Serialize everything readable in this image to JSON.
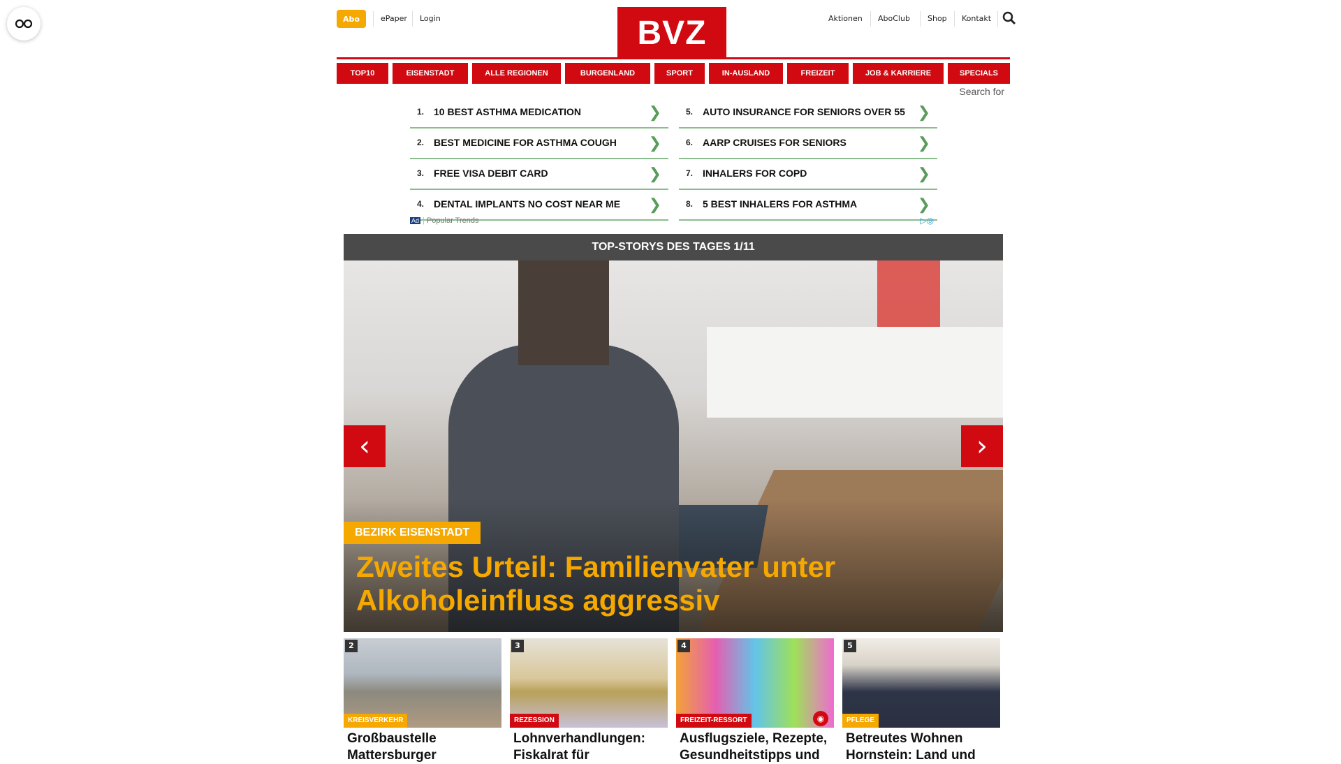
{
  "header": {
    "abo_label": "Abo",
    "left_links": [
      "ePaper",
      "Login"
    ],
    "logo_text": "BVZ",
    "right_links": [
      "Aktionen",
      "AboClub",
      "Shop",
      "Kontakt"
    ]
  },
  "nav": {
    "items": [
      "TOP10",
      "EISENSTADT",
      "ALLE REGIONEN",
      "BURGENLAND",
      "SPORT",
      "IN-AUSLAND",
      "FREIZEIT",
      "JOB & KARRIERE",
      "SPECIALS"
    ]
  },
  "search_for": "Search for",
  "ad": {
    "left": [
      {
        "num": "1.",
        "text": "10 BEST ASTHMA MEDICATION"
      },
      {
        "num": "2.",
        "text": "BEST MEDICINE FOR ASTHMA COUGH"
      },
      {
        "num": "3.",
        "text": "FREE VISA DEBIT CARD"
      },
      {
        "num": "4.",
        "text": "DENTAL IMPLANTS NO COST NEAR ME"
      }
    ],
    "right": [
      {
        "num": "5.",
        "text": "AUTO INSURANCE FOR SENIORS OVER 55"
      },
      {
        "num": "6.",
        "text": "AARP CRUISES FOR SENIORS"
      },
      {
        "num": "7.",
        "text": "INHALERS FOR COPD"
      },
      {
        "num": "8.",
        "text": "5 BEST INHALERS FOR ASTHMA"
      }
    ],
    "badge": "Ad",
    "footer": "Popular Trends"
  },
  "top_stories": {
    "heading": "TOP-STORYS DES TAGES 1/11",
    "hero_tag": "BEZIRK EISENSTADT",
    "hero_title": "Zweites Urteil: Familienvater unter Alkoholeinfluss aggressiv"
  },
  "cards": [
    {
      "rank": "2",
      "tag": "KREISVERKEHR",
      "tag_color": "#f5a800",
      "title": "Großbaustelle Mattersburger"
    },
    {
      "rank": "3",
      "tag": "REZESSION",
      "tag_color": "#d10a11",
      "title": "Lohnverhandlungen: Fiskalrat für"
    },
    {
      "rank": "4",
      "tag": "FREIZEIT-RESSORT",
      "tag_color": "#d10a11",
      "title": "Ausflugsziele, Rezepte, Gesundheitstipps und"
    },
    {
      "rank": "5",
      "tag": "PFLEGE",
      "tag_color": "#f5a800",
      "title": "Betreutes Wohnen Hornstein: Land und"
    }
  ],
  "colors": {
    "brand_red": "#d10a11",
    "accent_yellow": "#f5a800",
    "ad_green": "#5a9c5c"
  }
}
